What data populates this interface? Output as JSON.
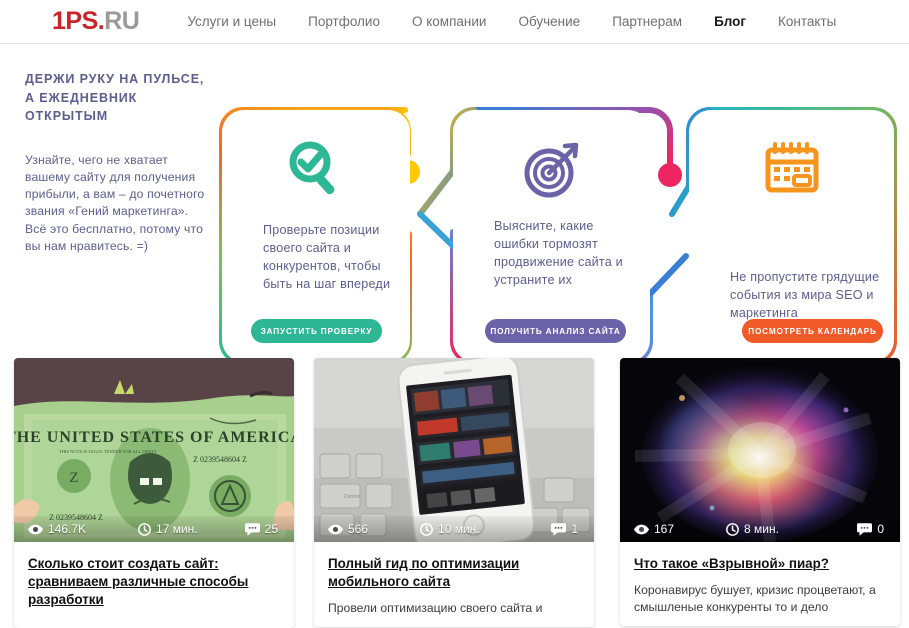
{
  "header": {
    "logo": {
      "red": "1PS.",
      "gray": "RU"
    },
    "nav": [
      {
        "label": "Услуги и цены",
        "active": false
      },
      {
        "label": "Портфолио",
        "active": false
      },
      {
        "label": "О компании",
        "active": false
      },
      {
        "label": "Обучение",
        "active": false
      },
      {
        "label": "Партнерам",
        "active": false
      },
      {
        "label": "Блог",
        "active": true
      },
      {
        "label": "Контакты",
        "active": false
      }
    ]
  },
  "promo": {
    "title": "ДЕРЖИ РУКУ НА ПУЛЬСЕ, А ЕЖЕДНЕВНИК ОТКРЫТЫМ",
    "text": "Узнайте, чего не хватает вашему сайту для получения прибыли, а вам – до почетного звания «Гений маркетинга». Всё это бесплатно, потому что вы нам нравитесь. =)",
    "cards": [
      {
        "icon": "magnifier-check-icon",
        "text": "Проверьте позиции своего сайта и конкурентов, чтобы быть на шаг впереди",
        "button": "ЗАПУСТИТЬ ПРОВЕРКУ",
        "button_color": "#2eb795",
        "icon_color": "#2eb795",
        "dot_color": "#ffc906"
      },
      {
        "icon": "target-arrow-icon",
        "text": "Выясните, какие ошибки тормозят продвижение сайта и устраните их",
        "button": "ПОЛУЧИТЬ АНАЛИЗ САЙТА",
        "button_color": "#6b63a8",
        "icon_color": "#6b63a8",
        "dot_color": "#ed2560"
      },
      {
        "icon": "calendar-icon",
        "text": "Не пропустите грядущие события из мира SEO и маркетинга",
        "button": "ПОСМОТРЕТЬ КАЛЕНДАРЬ",
        "button_color": "#f05a28",
        "icon_color": "#f7941e",
        "dot_color": "#ffc906"
      }
    ]
  },
  "blog": {
    "stat_labels": {
      "views": "views-icon",
      "time": "clock-icon",
      "comments": "comment-icon"
    },
    "posts": [
      {
        "thumb": "dollar-bill-cartoon",
        "views": "146.7K",
        "time": "17 мин.",
        "comments": "25",
        "title": "Сколько стоит создать сайт: сравниваем различные способы разработки",
        "excerpt": ""
      },
      {
        "thumb": "smartphone-on-keyboard",
        "views": "566",
        "time": "10 мин.",
        "comments": "1",
        "title": "Полный гид по оптимизации мобильного сайта",
        "excerpt": "Провели оптимизацию своего сайта и"
      },
      {
        "thumb": "color-powder-explosion",
        "views": "167",
        "time": "8 мин.",
        "comments": "0",
        "title": "Что такое «Взрывной» пиар?",
        "excerpt": "Коронавирус бушует, кризис процветают, а смышленые конкуренты то и дело"
      }
    ]
  }
}
